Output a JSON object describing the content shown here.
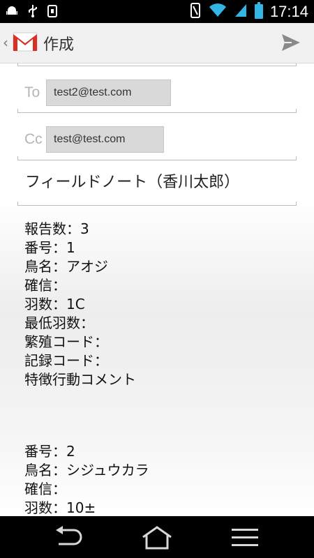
{
  "status_bar": {
    "time": "17:14",
    "left_icons": [
      "android-debug-icon",
      "usb-icon",
      "storage-icon"
    ],
    "right_icons": [
      "vibrate-icon",
      "wifi-icon",
      "signal-icon",
      "battery-icon"
    ]
  },
  "action_bar": {
    "title": "作成"
  },
  "compose": {
    "to_label": "To",
    "to_recipient": "test2@test.com",
    "cc_label": "Cc",
    "cc_recipient": "test@test.com",
    "subject": "フィールドノート（香川太郎）",
    "body_block1": [
      "報告数：3",
      "番号：1",
      "鳥名：アオジ",
      "確信：",
      "羽数：1C",
      "最低羽数：",
      "繁殖コード：",
      "記録コード：",
      "特徴行動コメント"
    ],
    "body_block2": [
      "番号：2",
      "鳥名：シジュウカラ",
      "確信：",
      "羽数：10±"
    ]
  },
  "colors": {
    "accent_gmail_red": "#d93025",
    "action_bar_bg": "#f1f1f1",
    "chip_bg": "#d9d9d9",
    "status_battery": "#33b5e5"
  }
}
